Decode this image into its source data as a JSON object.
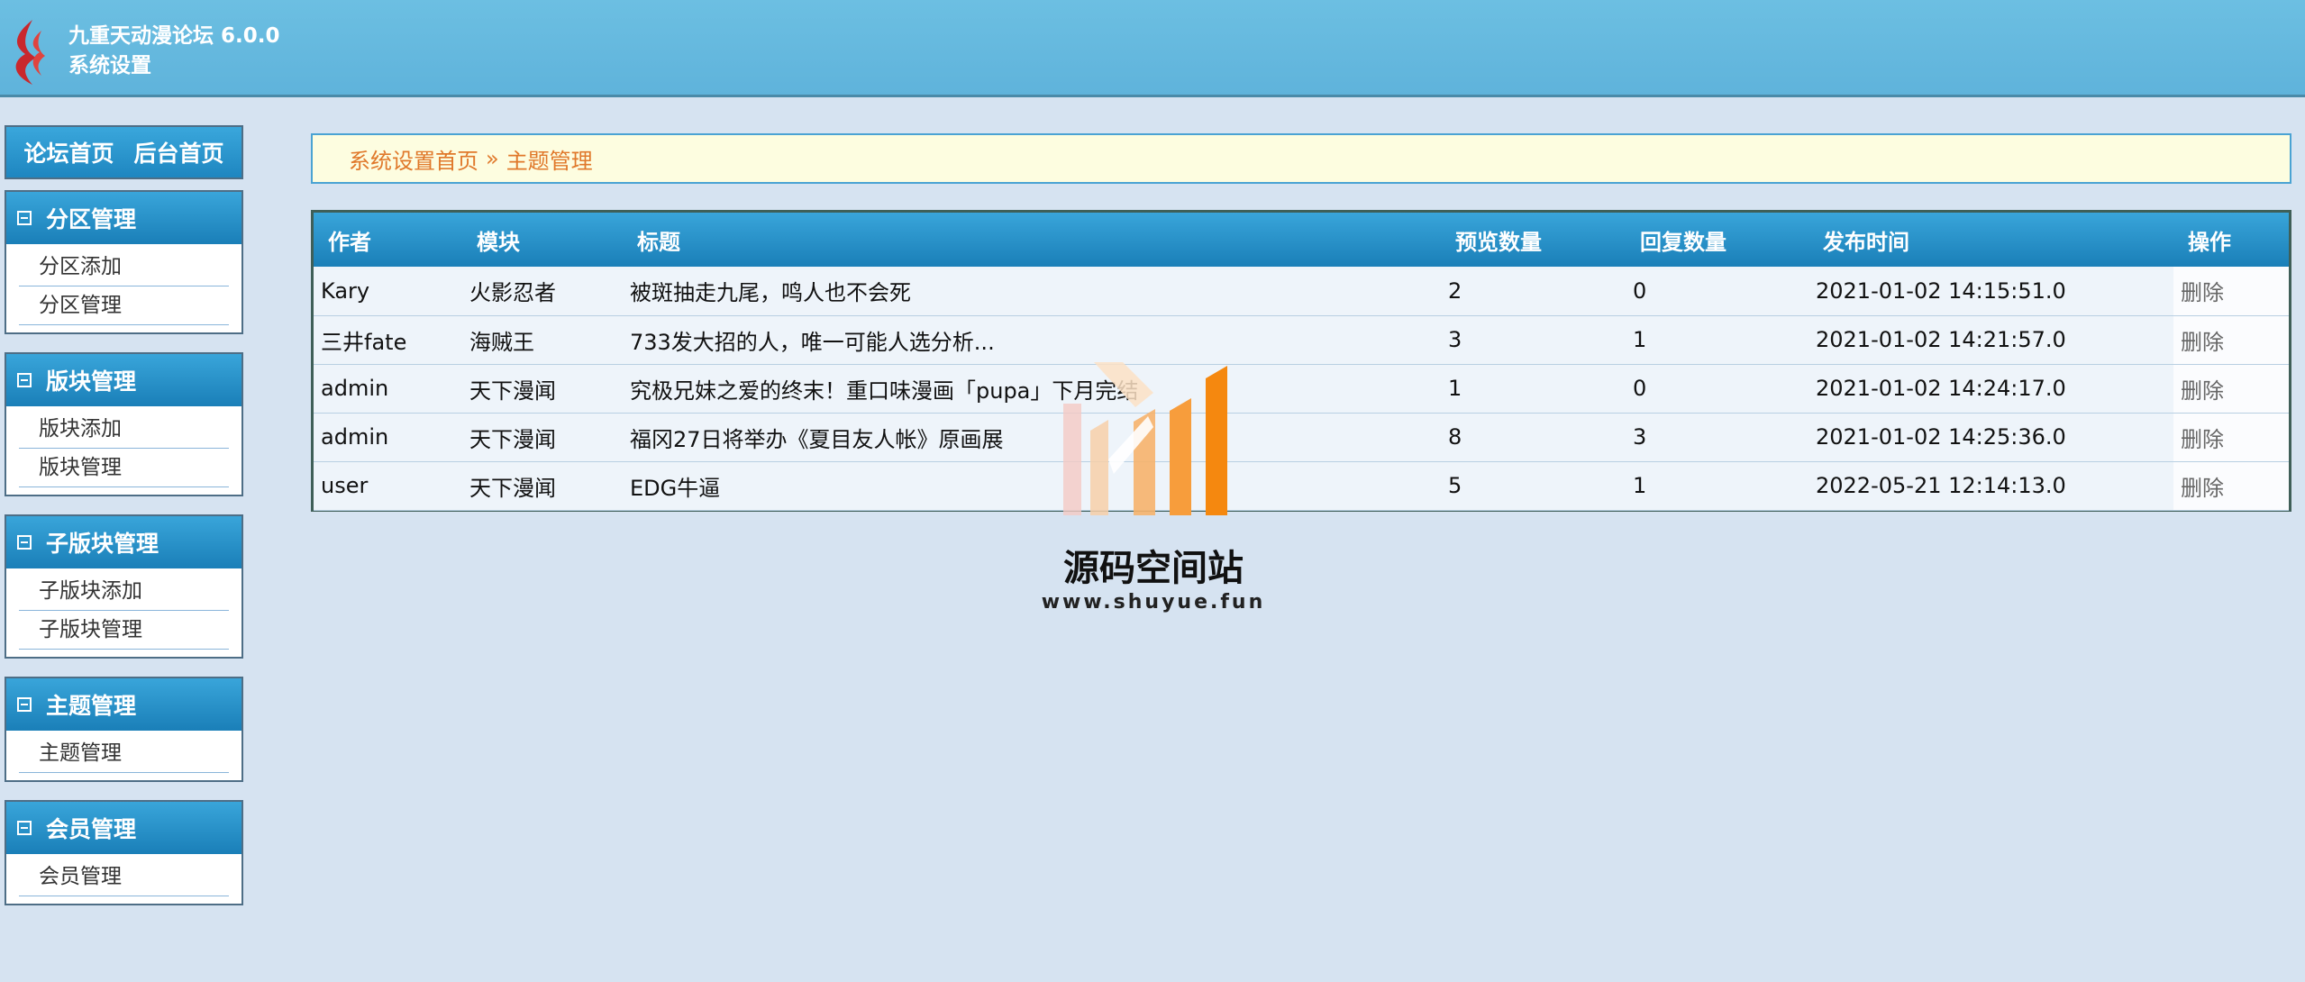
{
  "header": {
    "app_name": "九重天动漫论坛 6.0.0",
    "subtitle": "系统设置"
  },
  "sidebar": {
    "top_links": [
      "论坛首页",
      "后台首页"
    ],
    "panels": [
      {
        "title": "分区管理",
        "items": [
          "分区添加",
          "分区管理"
        ]
      },
      {
        "title": "版块管理",
        "items": [
          "版块添加",
          "版块管理"
        ]
      },
      {
        "title": "子版块管理",
        "items": [
          "子版块添加",
          "子版块管理"
        ]
      },
      {
        "title": "主题管理",
        "items": [
          "主题管理"
        ]
      },
      {
        "title": "会员管理",
        "items": [
          "会员管理"
        ]
      }
    ]
  },
  "breadcrumb": {
    "home": "系统设置首页",
    "separator": "»",
    "current": "主题管理"
  },
  "table": {
    "columns": [
      "作者",
      "模块",
      "标题",
      "预览数量",
      "回复数量",
      "发布时间",
      "操作"
    ],
    "rows": [
      [
        "Kary",
        "火影忍者",
        "被斑抽走九尾，鸣人也不会死",
        "2",
        "0",
        "2021-01-02 14:15:51.0",
        "删除"
      ],
      [
        "三井fate",
        "海贼王",
        "733发大招的人，唯一可能人选分析...",
        "3",
        "1",
        "2021-01-02 14:21:57.0",
        "删除"
      ],
      [
        "admin",
        "天下漫闻",
        "究极兄妹之爱的终末！重口味漫画「pupa」下月完结",
        "1",
        "0",
        "2021-01-02 14:24:17.0",
        "删除"
      ],
      [
        "admin",
        "天下漫闻",
        "福冈27日将举办《夏目友人帐》原画展",
        "8",
        "3",
        "2021-01-02 14:25:36.0",
        "删除"
      ],
      [
        "user",
        "天下漫闻",
        "EDG牛逼",
        "5",
        "1",
        "2022-05-21 12:14:13.0",
        "删除"
      ]
    ]
  },
  "watermark": {
    "name": "源码空间站",
    "url": "www.shuyue.fun"
  },
  "colors": {
    "header": "#5fb3db",
    "accent_blue": "#1e86c0",
    "page_bg": "#d6e3f1",
    "breadcrumb_text": "#e0782a",
    "watermark_orange": "#f5880f"
  }
}
